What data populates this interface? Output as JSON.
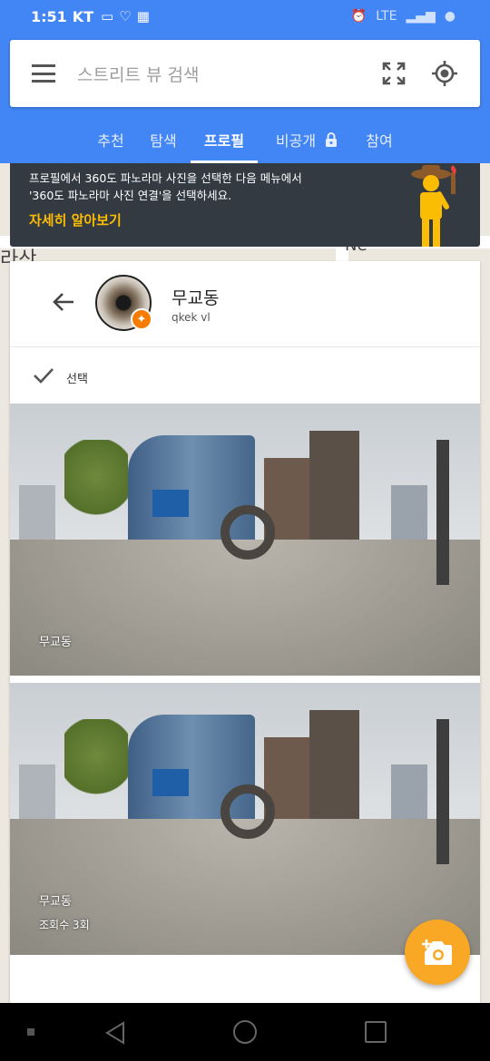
{
  "status_bar": {
    "time": "1:51",
    "carrier": "KT",
    "network": "LTE"
  },
  "search": {
    "placeholder": "스트리트 뷰 검색",
    "icons": [
      "menu-icon",
      "expand-icon",
      "my-location-icon"
    ]
  },
  "tabs": [
    {
      "label": "추천",
      "active": false
    },
    {
      "label": "탐색",
      "active": false
    },
    {
      "label": "프로필",
      "active": true
    },
    {
      "label": "비공개",
      "active": false,
      "icon": "lock-icon"
    },
    {
      "label": "참여",
      "active": false
    }
  ],
  "banner": {
    "line1": "프로필에서 360도 파노라마 사진을 선택한 다음 메뉴에서",
    "line2": "'360도 파노라마 사진 연결'을 선택하세요.",
    "link": "자세히 알아보기"
  },
  "profile": {
    "name": "무교동",
    "subtitle": "qkek vl",
    "select_label": "선택"
  },
  "photos": [
    {
      "title": "무교동",
      "views": ""
    },
    {
      "title": "무교동",
      "views": "조회수 3회"
    }
  ],
  "map_labels": [
    "라산",
    "Ne"
  ],
  "colors": {
    "header_blue": "#4285f4",
    "banner_bg": "#333a42",
    "link_yellow": "#fbbc04",
    "fab_orange": "#f9a825"
  }
}
